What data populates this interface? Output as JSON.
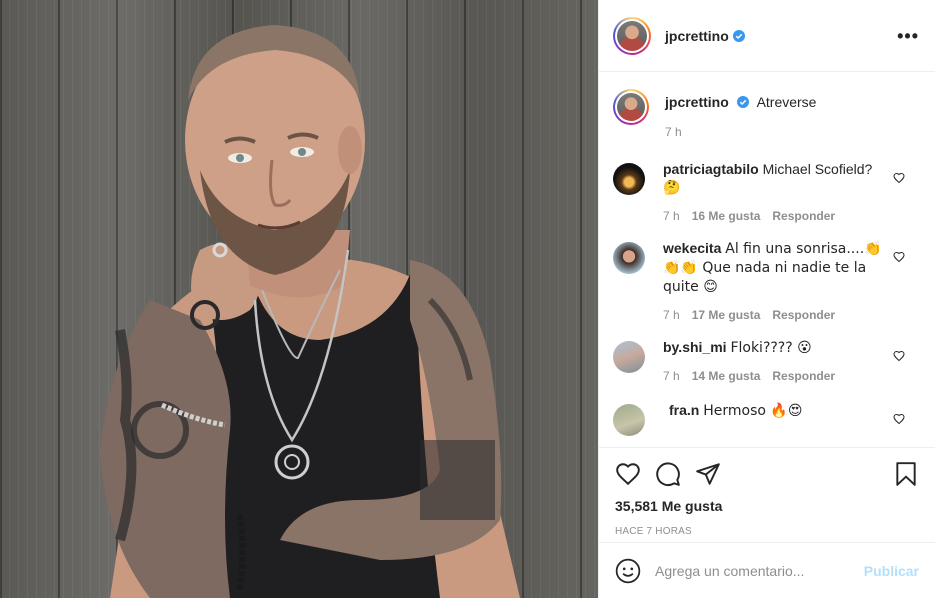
{
  "post": {
    "author": {
      "username": "jpcrettino",
      "verified": true,
      "avatar_icon": "avatar-jpcrettino"
    },
    "caption": {
      "text": "Atreverse",
      "time": "7 h"
    },
    "colors": {
      "accent": "#0095f6",
      "verified": "#3897f0",
      "muted": "#8e8e8e",
      "publish_disabled": "#b2dffc",
      "border": "#efefef"
    }
  },
  "comments": [
    {
      "user": "patriciagtabilo",
      "text": "Michael Scofield?",
      "second_line": "🤔",
      "time": "7 h",
      "likes": "16 Me gusta",
      "reply": "Responder"
    },
    {
      "user": "wekecita",
      "text": "Al fin una sonrisa....👏",
      "second_line": "👏👏 Que nada ni nadie te la",
      "third_line": "quite 😊",
      "time": "7 h",
      "likes": "17 Me gusta",
      "reply": "Responder"
    },
    {
      "user": "by.shi_mi",
      "text": "Floki???? 😮",
      "time": "7 h",
      "likes": "14 Me gusta",
      "reply": "Responder"
    },
    {
      "user": "fra.n",
      "text": "Hermoso 🔥😍"
    }
  ],
  "actions": {
    "like_icon": "heart-icon",
    "comment_icon": "comment-icon",
    "share_icon": "share-icon",
    "save_icon": "bookmark-icon",
    "likes": "35,581 Me gusta",
    "time_ago": "HACE 7 HORAS"
  },
  "add_comment": {
    "placeholder": "Agrega un comentario...",
    "publish_label": "Publicar",
    "emoji_icon": "smile-icon"
  },
  "header": {
    "more_icon": "more-options-icon",
    "more_label": "•••"
  }
}
